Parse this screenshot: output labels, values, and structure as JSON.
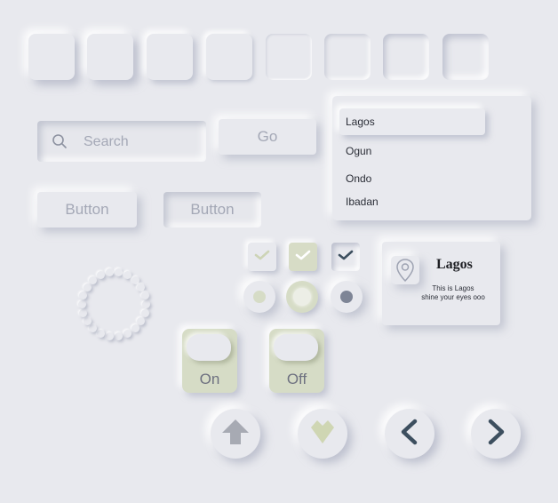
{
  "tiles": [
    "tile-1",
    "tile-2",
    "tile-3",
    "tile-4",
    "tile-5",
    "tile-6",
    "tile-7",
    "tile-8"
  ],
  "search": {
    "placeholder": "Search",
    "icon": "search-icon"
  },
  "go_button": {
    "label": "Go"
  },
  "buttons": {
    "raised_label": "Button",
    "inset_label": "Button"
  },
  "dropdown": {
    "selected": "Lagos",
    "options": [
      "Lagos",
      "Ogun",
      "Ondo",
      "Ibadan"
    ]
  },
  "checkboxes": [
    {
      "state": "checked-light"
    },
    {
      "state": "checked-accent"
    },
    {
      "state": "checked-pressed"
    }
  ],
  "radios": [
    {
      "state": "light"
    },
    {
      "state": "accent"
    },
    {
      "state": "dark"
    }
  ],
  "card": {
    "icon": "map-pin-icon",
    "title": "Lagos",
    "line1": "This is Lagos",
    "line2": "shine your eyes ooo"
  },
  "toggles": {
    "on_label": "On",
    "off_label": "Off"
  },
  "round_buttons": [
    "arrow-up-icon",
    "heart-icon",
    "chevron-left-icon",
    "chevron-right-icon"
  ],
  "colors": {
    "background": "#e8e9ee",
    "accent": "#d6dcc6",
    "accent_dark": "#c9d1b2",
    "icon_dark": "#3d4f5f",
    "muted_text": "#a4a8b6"
  }
}
